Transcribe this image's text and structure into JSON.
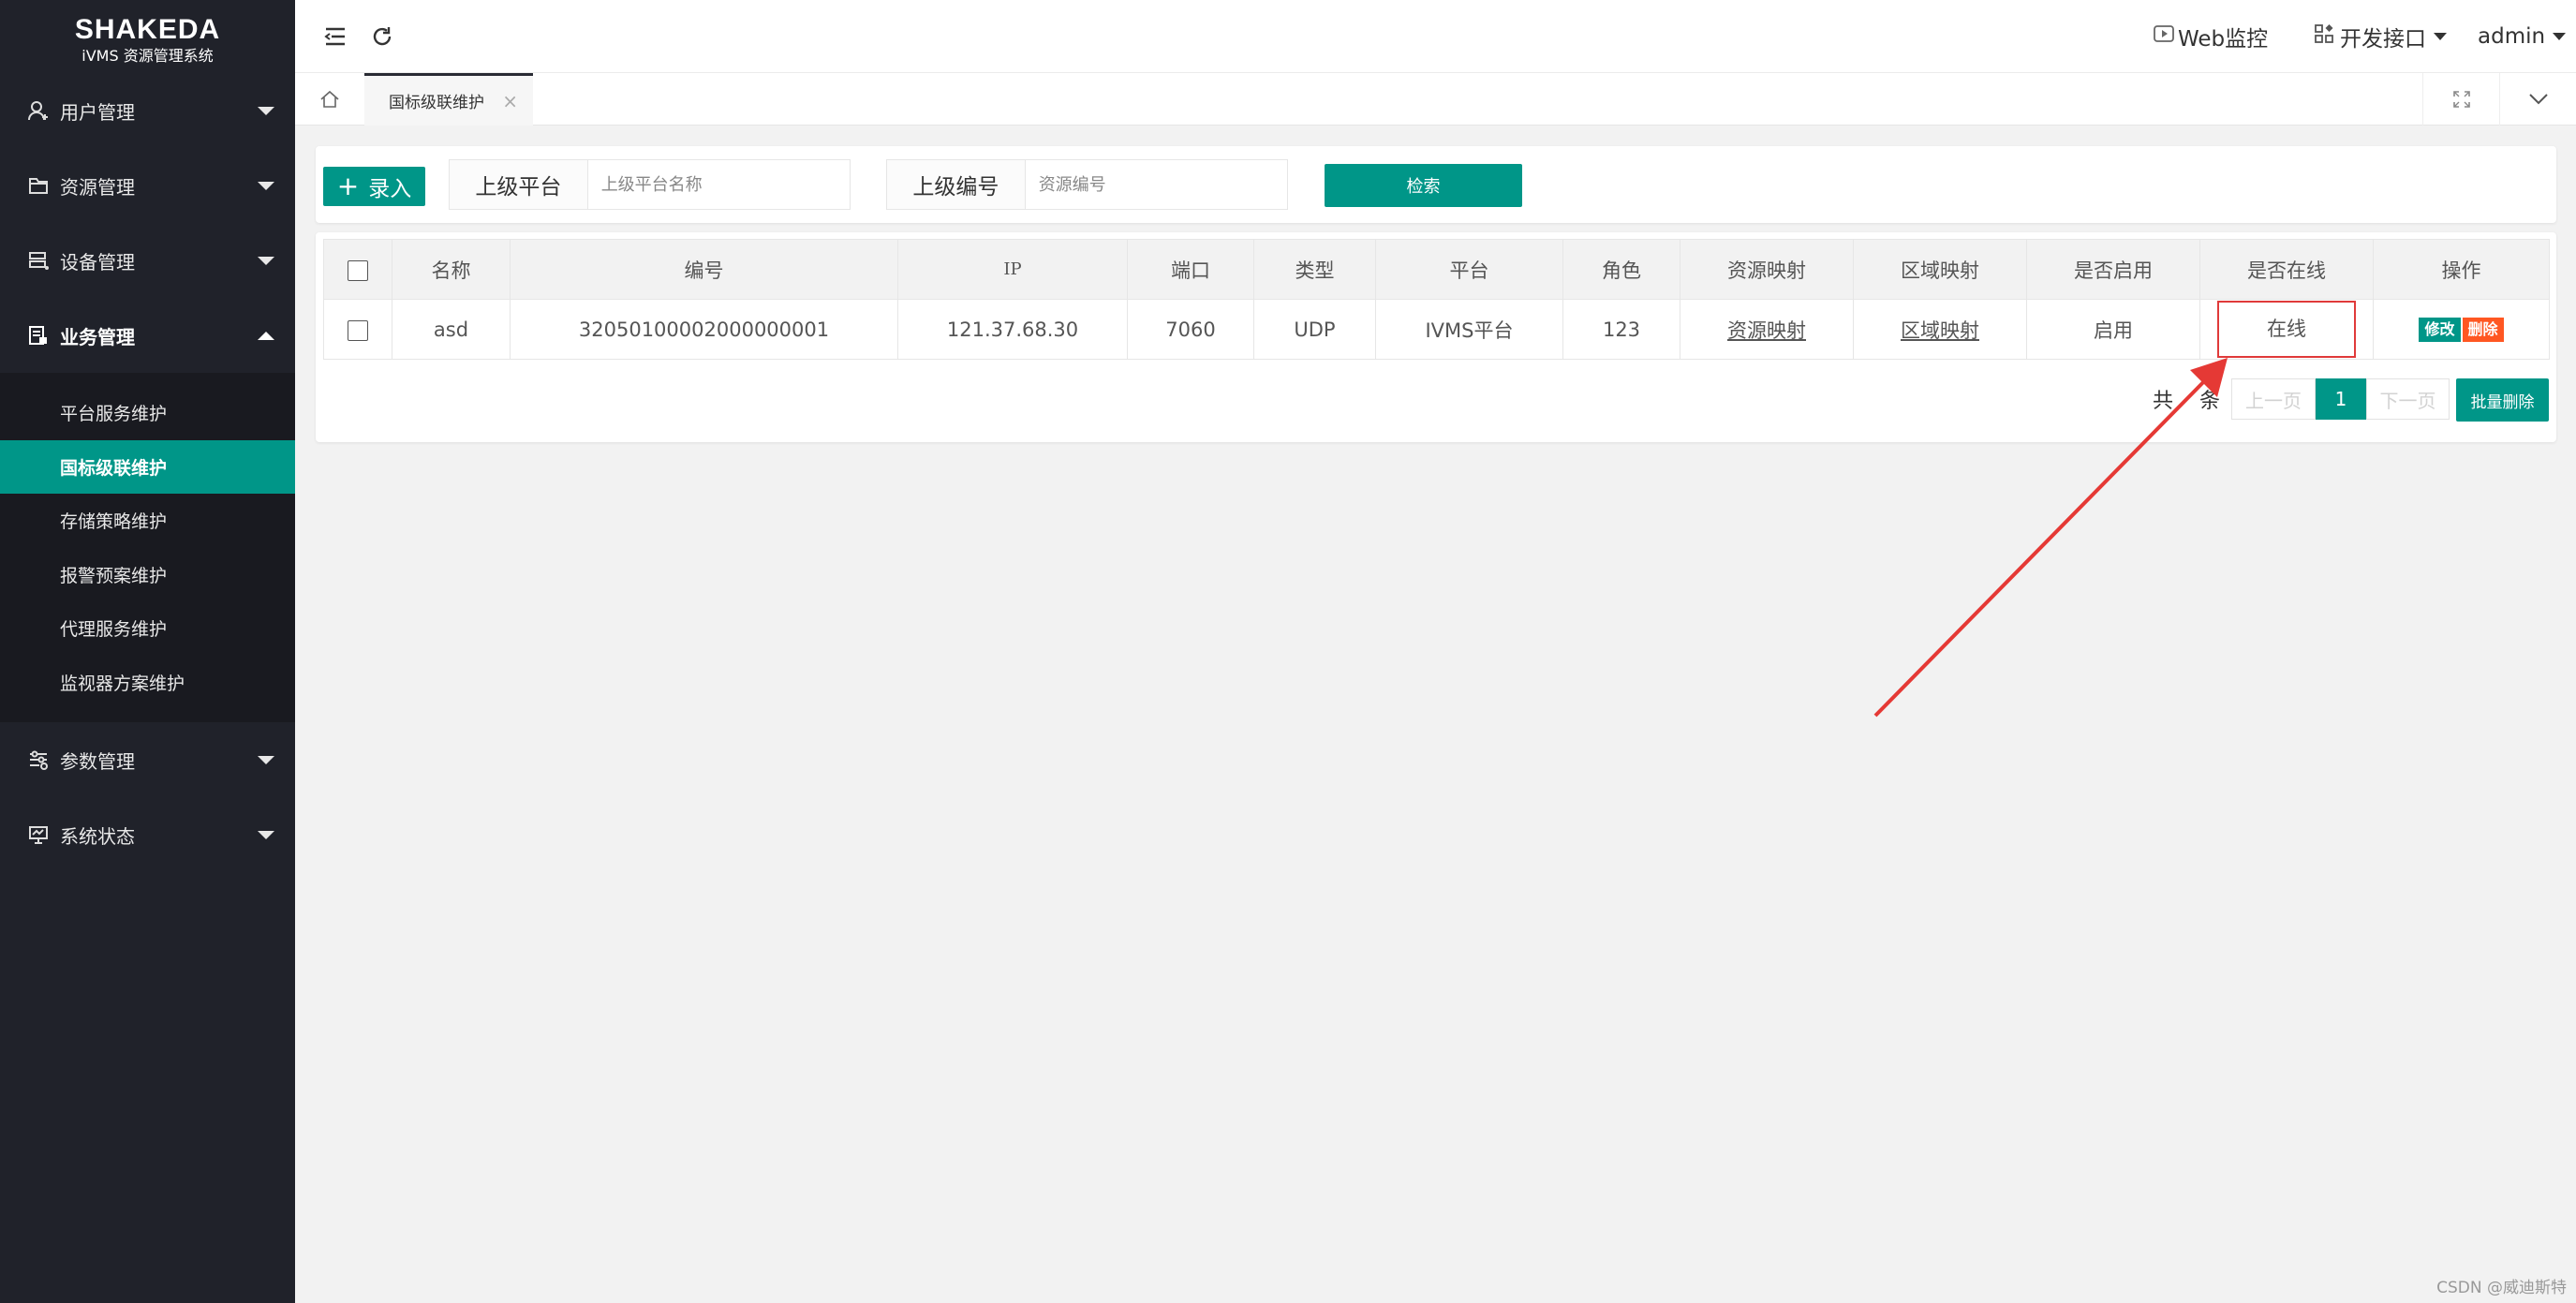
{
  "app": {
    "brand": "SHAKEDA",
    "subtitle": "iVMS 资源管理系统"
  },
  "sidebar": {
    "items": [
      {
        "label": "用户管理",
        "icon": "user-icon"
      },
      {
        "label": "资源管理",
        "icon": "folder-icon"
      },
      {
        "label": "设备管理",
        "icon": "device-icon"
      },
      {
        "label": "业务管理",
        "icon": "briefcase-icon",
        "expanded": true,
        "children": [
          {
            "label": "平台服务维护"
          },
          {
            "label": "国标级联维护",
            "active": true
          },
          {
            "label": "存储策略维护"
          },
          {
            "label": "报警预案维护"
          },
          {
            "label": "代理服务维护"
          },
          {
            "label": "监视器方案维护"
          }
        ]
      },
      {
        "label": "参数管理",
        "icon": "sliders-icon"
      },
      {
        "label": "系统状态",
        "icon": "monitor-icon"
      }
    ]
  },
  "header": {
    "web_monitor": "Web监控",
    "dev_api": "开发接口",
    "user": "admin"
  },
  "tabs": {
    "active": "国标级联维护",
    "close": "×"
  },
  "search": {
    "add_label": "录入",
    "platform_label": "上级平台",
    "platform_placeholder": "上级平台名称",
    "code_label": "上级编号",
    "code_placeholder": "资源编号",
    "search_button": "检索"
  },
  "table": {
    "columns": [
      "名称",
      "编号",
      "IP",
      "端口",
      "类型",
      "平台",
      "角色",
      "资源映射",
      "区域映射",
      "是否启用",
      "是否在线",
      "操作"
    ],
    "rows": [
      {
        "name": "asd",
        "code": "32050100002000000001",
        "ip": "121.37.68.30",
        "port": "7060",
        "type": "UDP",
        "platform": "IVMS平台",
        "role": "123",
        "resource_map": "资源映射",
        "area_map": "区域映射",
        "enabled": "启用",
        "online": "在线",
        "edit": "修改",
        "delete": "删除"
      }
    ]
  },
  "pagination": {
    "total_prefix": "共",
    "total_suffix": "条",
    "prev": "上一页",
    "current": "1",
    "next": "下一页",
    "batch_delete": "批量删除"
  },
  "watermark": "CSDN @威迪斯特",
  "colors": {
    "primary": "#009688",
    "danger": "#ff5722",
    "sidebar_bg": "#20222a",
    "annotation": "#e03a3a"
  }
}
